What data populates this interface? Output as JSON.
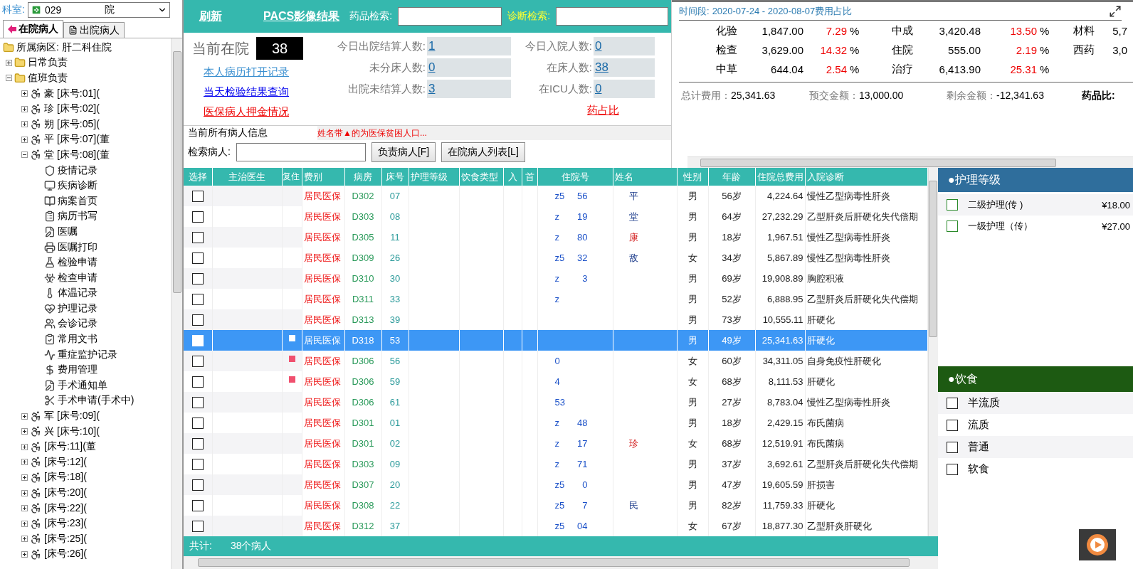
{
  "department": {
    "label": "科室:",
    "value": "029",
    "value_tail": "院"
  },
  "patient_tabs": [
    {
      "label": "在院病人",
      "selected": true
    },
    {
      "label": "出院病人",
      "selected": false
    }
  ],
  "tree": {
    "label": "所属病区: 肝二科住院",
    "kind": "folder",
    "children": [
      {
        "label": "日常负责",
        "kind": "folder",
        "expanded": false
      },
      {
        "label": "值班负责",
        "kind": "folder",
        "expanded": true,
        "children": [
          {
            "label": "豪 [床号:01](",
            "kind": "patient",
            "expanded": false
          },
          {
            "label": "珍 [床号:02](",
            "kind": "patient",
            "expanded": false
          },
          {
            "label": "朔 [床号:05](",
            "kind": "patient",
            "expanded": false
          },
          {
            "label": "平 [床号:07](董",
            "kind": "patient",
            "expanded": false
          },
          {
            "label": "堂 [床号:08](董",
            "kind": "patient",
            "expanded": true,
            "children": [
              {
                "label": "疫情记录",
                "kind": "action"
              },
              {
                "label": "疾病诊断",
                "kind": "action"
              },
              {
                "label": "病案首页",
                "kind": "action"
              },
              {
                "label": "病历书写",
                "kind": "action"
              },
              {
                "label": "医嘱",
                "kind": "action"
              },
              {
                "label": "医嘱打印",
                "kind": "action"
              },
              {
                "label": "检验申请",
                "kind": "action"
              },
              {
                "label": "检查申请",
                "kind": "action"
              },
              {
                "label": "体温记录",
                "kind": "action"
              },
              {
                "label": "护理记录",
                "kind": "action"
              },
              {
                "label": "会诊记录",
                "kind": "action"
              },
              {
                "label": "常用文书",
                "kind": "action"
              },
              {
                "label": "重症监护记录",
                "kind": "action"
              },
              {
                "label": "费用管理",
                "kind": "action"
              },
              {
                "label": "手术通知单",
                "kind": "action"
              },
              {
                "label": "手术申请(手术中)",
                "kind": "action"
              }
            ]
          },
          {
            "label": "军 [床号:09](",
            "kind": "patient",
            "expanded": false
          },
          {
            "label": "兴 [床号:10](",
            "kind": "patient",
            "expanded": false
          },
          {
            "label": "[床号:11](董",
            "kind": "patient",
            "expanded": false
          },
          {
            "label": "[床号:12](",
            "kind": "patient",
            "expanded": false
          },
          {
            "label": "[床号:18](",
            "kind": "patient",
            "expanded": false
          },
          {
            "label": "[床号:20](",
            "kind": "patient",
            "expanded": false
          },
          {
            "label": "[床号:22](",
            "kind": "patient",
            "expanded": false
          },
          {
            "label": "[床号:23](",
            "kind": "patient",
            "expanded": false
          },
          {
            "label": "[床号:25](",
            "kind": "patient",
            "expanded": false
          },
          {
            "label": "[床号:26](",
            "kind": "patient",
            "expanded": false
          }
        ]
      }
    ]
  },
  "toolbar": {
    "links": [
      "刷新",
      "PACS影像结果"
    ],
    "drug_search_label": "药品检索:",
    "diagnosis_search_label": "诊断检索:"
  },
  "census": {
    "label": "当前在院",
    "count": "38"
  },
  "quick_links": [
    {
      "label": "本人病历打开记录",
      "color": "#3a8fd0"
    },
    {
      "label": "当天检验结果查询",
      "color": "#0000ee"
    },
    {
      "label": "医保病人押金情况",
      "color": "#ee0000"
    }
  ],
  "stats": [
    {
      "label": "今日出院结算人数:",
      "value": "1"
    },
    {
      "label": "今日入院人数:",
      "value": "0"
    },
    {
      "label": "未分床人数:",
      "value": "0"
    },
    {
      "label": "在床人数:",
      "value": "38"
    },
    {
      "label": "出院未结算人数:",
      "value": "3"
    },
    {
      "label": "在ICU人数:",
      "value": "0"
    }
  ],
  "drug_ratio_link": "药占比",
  "patient_info": {
    "legend": "当前所有病人信息",
    "note": "姓名带▲的为医保贫困人口...",
    "search_label": "检索病人:",
    "buttons": [
      "负责病人[F]",
      "在院病人列表[L]"
    ]
  },
  "cost_summary": {
    "period_label": "时间段:",
    "period": "2020-07-24 - 2020-08-07费用占比",
    "items": [
      {
        "label": "化验",
        "amount": "1,847.00",
        "percent": "7.29",
        "unit": "%"
      },
      {
        "label": "中成",
        "amount": "3,420.48",
        "percent": "13.50",
        "unit": "%"
      },
      {
        "label": "材料",
        "amount": "5,7"
      },
      {
        "label": "检查",
        "amount": "3,629.00",
        "percent": "14.32",
        "unit": "%"
      },
      {
        "label": "住院",
        "amount": "555.00",
        "percent": "2.19",
        "unit": "%"
      },
      {
        "label": "西药",
        "amount": "3,0"
      },
      {
        "label": "中草",
        "amount": "644.04",
        "percent": "2.54",
        "unit": "%"
      },
      {
        "label": "治疗",
        "amount": "6,413.90",
        "percent": "25.31",
        "unit": "%"
      }
    ],
    "totals": [
      {
        "label": "总计费用：",
        "value": "25,341.63"
      },
      {
        "label": "预交金额：",
        "value": "13,000.00"
      },
      {
        "label": "剩余金额：",
        "value": "-12,341.63"
      }
    ],
    "drug_ratio_label": "药品比:"
  },
  "table": {
    "columns": [
      "选择",
      "主治医生",
      "复住",
      "费别",
      "病房",
      "床号",
      "护理等级",
      "饮食类型",
      "入",
      "首",
      "住院号",
      "姓名",
      "性别",
      "年龄",
      "住院总费用",
      "入院诊断"
    ],
    "rows": [
      {
        "checked": false,
        "selected": false,
        "fee_type": "居民医保",
        "ward": "D302",
        "bed": "07",
        "hospital_no": [
          "z5",
          "56"
        ],
        "name": "平",
        "name_flagged": false,
        "sex": "男",
        "age": "56岁",
        "cost": "4,224.64",
        "diagnosis": "慢性乙型病毒性肝炎"
      },
      {
        "checked": false,
        "selected": false,
        "fee_type": "居民医保",
        "ward": "D303",
        "bed": "08",
        "hospital_no": [
          "z",
          "19"
        ],
        "name": "堂",
        "name_flagged": false,
        "sex": "男",
        "age": "64岁",
        "cost": "27,232.29",
        "diagnosis": "乙型肝炎后肝硬化失代偿期"
      },
      {
        "checked": false,
        "selected": false,
        "fee_type": "居民医保",
        "ward": "D305",
        "bed": "11",
        "hospital_no": [
          "z",
          "80"
        ],
        "name": "康",
        "name_flagged": true,
        "sex": "男",
        "age": "18岁",
        "cost": "1,967.51",
        "diagnosis": "慢性乙型病毒性肝炎"
      },
      {
        "checked": false,
        "selected": false,
        "fee_type": "居民医保",
        "ward": "D309",
        "bed": "26",
        "hospital_no": [
          "z5",
          "32"
        ],
        "name": "敌",
        "name_flagged": false,
        "sex": "女",
        "age": "34岁",
        "cost": "5,867.89",
        "diagnosis": "慢性乙型病毒性肝炎"
      },
      {
        "checked": false,
        "selected": false,
        "fee_type": "居民医保",
        "ward": "D310",
        "bed": "30",
        "hospital_no": [
          "z",
          "3"
        ],
        "sex": "男",
        "age": "69岁",
        "cost": "19,908.89",
        "diagnosis": "胸腔积液"
      },
      {
        "checked": false,
        "selected": false,
        "fee_type": "居民医保",
        "ward": "D311",
        "bed": "33",
        "hospital_no": [
          "z"
        ],
        "sex": "男",
        "age": "52岁",
        "cost": "6,888.95",
        "diagnosis": "乙型肝炎后肝硬化失代偿期"
      },
      {
        "checked": false,
        "selected": false,
        "fee_type": "居民医保",
        "ward": "D313",
        "bed": "39",
        "sex": "男",
        "age": "73岁",
        "cost": "10,555.11",
        "diagnosis": "肝硬化"
      },
      {
        "checked": false,
        "selected": true,
        "marker": {
          "color": "#ffffff"
        },
        "fee_type": "居民医保",
        "ward": "D318",
        "bed": "53",
        "sex": "男",
        "age": "49岁",
        "cost": "25,341.63",
        "diagnosis": "肝硬化"
      },
      {
        "checked": false,
        "selected": false,
        "marker": {
          "color": "#f0506e"
        },
        "fee_type": "居民医保",
        "ward": "D306",
        "bed": "56",
        "hospital_no": [
          "0"
        ],
        "sex": "女",
        "age": "60岁",
        "cost": "34,311.05",
        "diagnosis": "自身免疫性肝硬化"
      },
      {
        "checked": false,
        "selected": false,
        "marker": {
          "color": "#f0506e"
        },
        "fee_type": "居民医保",
        "ward": "D306",
        "bed": "59",
        "hospital_no": [
          "4"
        ],
        "sex": "女",
        "age": "68岁",
        "cost": "8,111.53",
        "diagnosis": "肝硬化"
      },
      {
        "checked": false,
        "selected": false,
        "fee_type": "居民医保",
        "ward": "D306",
        "bed": "61",
        "hospital_no": [
          "53"
        ],
        "sex": "男",
        "age": "27岁",
        "cost": "8,783.04",
        "diagnosis": "慢性乙型病毒性肝炎"
      },
      {
        "checked": false,
        "selected": false,
        "fee_type": "居民医保",
        "ward": "D301",
        "bed": "01",
        "hospital_no": [
          "z",
          "48"
        ],
        "sex": "男",
        "age": "18岁",
        "cost": "2,429.15",
        "diagnosis": "布氏菌病"
      },
      {
        "checked": false,
        "selected": false,
        "fee_type": "居民医保",
        "ward": "D301",
        "bed": "02",
        "hospital_no": [
          "z",
          "17"
        ],
        "name": "珍",
        "name_flagged": true,
        "sex": "女",
        "age": "68岁",
        "cost": "12,519.91",
        "diagnosis": "布氏菌病"
      },
      {
        "checked": false,
        "selected": false,
        "fee_type": "居民医保",
        "ward": "D303",
        "bed": "09",
        "hospital_no": [
          "z",
          "71"
        ],
        "sex": "男",
        "age": "37岁",
        "cost": "3,692.61",
        "diagnosis": "乙型肝炎后肝硬化失代偿期"
      },
      {
        "checked": false,
        "selected": false,
        "fee_type": "居民医保",
        "ward": "D307",
        "bed": "20",
        "hospital_no": [
          "z5",
          "0"
        ],
        "sex": "男",
        "age": "47岁",
        "cost": "19,605.59",
        "diagnosis": "肝损害"
      },
      {
        "checked": false,
        "selected": false,
        "fee_type": "居民医保",
        "ward": "D308",
        "bed": "22",
        "hospital_no": [
          "z5",
          "7"
        ],
        "name": "民",
        "name_flagged": false,
        "sex": "男",
        "age": "82岁",
        "cost": "11,759.33",
        "diagnosis": "肝硬化"
      },
      {
        "checked": false,
        "selected": false,
        "fee_type": "居民医保",
        "ward": "D312",
        "bed": "37",
        "hospital_no": [
          "z5",
          "04"
        ],
        "sex": "女",
        "age": "67岁",
        "cost": "18,877.30",
        "diagnosis": "乙型肝炎肝硬化"
      }
    ],
    "footer": {
      "label": "共计:",
      "count": "38个病人"
    }
  },
  "nursing": {
    "title": "●护理等级",
    "options": [
      {
        "label": "二级护理(传 )",
        "price": "¥18.00",
        "checked": false
      },
      {
        "label": "一级护理（传）",
        "price": "¥27.00",
        "checked": false
      }
    ]
  },
  "diet": {
    "title": "●饮食",
    "options": [
      {
        "label": "半流质",
        "checked": false
      },
      {
        "label": "流质",
        "checked": false
      },
      {
        "label": "普通",
        "checked": false
      },
      {
        "label": "软食",
        "checked": false
      }
    ]
  }
}
